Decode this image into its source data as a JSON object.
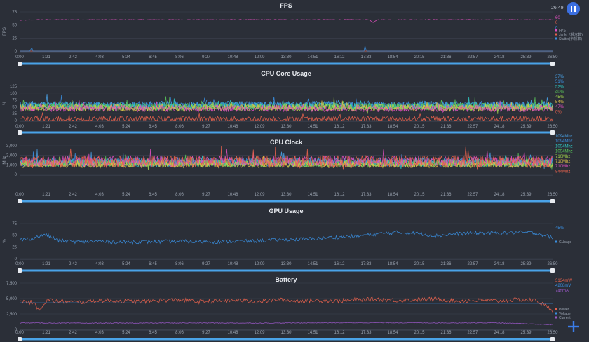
{
  "app": {
    "elapsed": "26:49",
    "colors": {
      "fps": "#e04fbf",
      "jank": "#e8624d",
      "stutter": "#3a8fe0",
      "gpu": "#3a8fe0",
      "power": "#e8624d",
      "voltage": "#3a8fe0",
      "current": "#9b59c9",
      "scrollbar": "#4aa3e8"
    },
    "icons": {
      "pause": "pause-icon",
      "add": "plus-icon"
    }
  },
  "time_axis": [
    "0:00",
    "1:21",
    "2:42",
    "4:03",
    "5:24",
    "6:45",
    "8:06",
    "9:27",
    "10:48",
    "12:09",
    "13:30",
    "14:51",
    "16:12",
    "17:33",
    "18:54",
    "20:15",
    "21:36",
    "22:57",
    "24:18",
    "25:39",
    "26:50"
  ],
  "chart_data": [
    {
      "id": "fps",
      "type": "line",
      "title": "FPS",
      "ylabel": "FPS",
      "ylim": [
        0,
        75
      ],
      "yticks": [
        "0",
        "25",
        "50",
        "75"
      ],
      "x_range_min": [
        0,
        26.83
      ],
      "current_values": [
        "60",
        "0",
        "0"
      ],
      "legend": [
        "FPS",
        "Jank(卡顿次数)",
        "Stutter(卡顿率)"
      ],
      "grid": true,
      "series": [
        {
          "name": "FPS",
          "color": "#e04fbf",
          "x": [
            0,
            1,
            2,
            3,
            4,
            5,
            6,
            7,
            8,
            9,
            10,
            11,
            12,
            13,
            14,
            15,
            16,
            17,
            17.6,
            17.8,
            18,
            19,
            20,
            21,
            22,
            23,
            24,
            25,
            26,
            26.83
          ],
          "values": [
            59,
            60,
            60,
            60,
            60,
            60,
            60,
            60,
            60,
            60,
            60,
            60,
            60,
            60,
            60,
            60,
            60,
            60,
            60,
            54,
            60,
            60,
            60,
            60,
            60,
            60,
            60,
            60,
            60,
            60
          ]
        },
        {
          "name": "Jank(卡顿次数)",
          "color": "#e8624d",
          "x": [
            0,
            26.83
          ],
          "values": [
            0,
            0
          ]
        },
        {
          "name": "Stutter(卡顿率)",
          "color": "#3a8fe0",
          "x": [
            0,
            0.55,
            0.6,
            0.65,
            17.35,
            17.4,
            17.45,
            26.83
          ],
          "values": [
            0,
            0,
            10,
            0,
            0,
            13,
            0,
            0
          ]
        }
      ]
    },
    {
      "id": "cpu_usage",
      "type": "line",
      "title": "CPU Core Usage",
      "ylabel": "%",
      "ylim": [
        0,
        125
      ],
      "yticks": [
        "0",
        "25",
        "50",
        "75",
        "100",
        "125"
      ],
      "x_range_min": [
        0,
        26.83
      ],
      "current_values": [
        "37%",
        "51%",
        "52%",
        "40%",
        "45%",
        "54%",
        "47%",
        "0%"
      ],
      "grid": true,
      "series": [
        {
          "name": "cpu0",
          "color": "#4aa3e8",
          "base": 57,
          "amp": 14
        },
        {
          "name": "cpu1",
          "color": "#3a8fe0",
          "base": 55,
          "amp": 14
        },
        {
          "name": "cpu2",
          "color": "#2fc6c0",
          "base": 52,
          "amp": 13
        },
        {
          "name": "cpu3",
          "color": "#5ac85a",
          "base": 50,
          "amp": 14
        },
        {
          "name": "cpu4",
          "color": "#a4d84a",
          "base": 48,
          "amp": 13
        },
        {
          "name": "cpu5",
          "color": "#e0c04a",
          "base": 46,
          "amp": 12
        },
        {
          "name": "cpu6",
          "color": "#e04fbf",
          "base": 44,
          "amp": 12
        },
        {
          "name": "cpu7",
          "color": "#e8624d",
          "base": 6,
          "amp": 10
        }
      ]
    },
    {
      "id": "cpu_clock",
      "type": "line",
      "title": "CPU Clock",
      "ylabel": "MHz",
      "ylim": [
        0,
        3000
      ],
      "yticks": [
        "0",
        "1,000",
        "2,000",
        "3,000"
      ],
      "x_range_min": [
        0,
        26.83
      ],
      "current_values": [
        "1094Mhz",
        "1094Mhz",
        "1094Mhz",
        "1094Mhz",
        "710Mhz",
        "710Mhz",
        "710Mhz",
        "844Mhz"
      ],
      "grid": true,
      "series": [
        {
          "name": "clock0",
          "color": "#4aa3e8",
          "base": 1300,
          "amp": 450
        },
        {
          "name": "clock1",
          "color": "#3a8fe0",
          "base": 1250,
          "amp": 420
        },
        {
          "name": "clock2",
          "color": "#2fc6c0",
          "base": 1200,
          "amp": 400
        },
        {
          "name": "clock3",
          "color": "#5ac85a",
          "base": 1150,
          "amp": 380
        },
        {
          "name": "clock4",
          "color": "#a4d84a",
          "base": 1100,
          "amp": 360
        },
        {
          "name": "clock5",
          "color": "#e0c04a",
          "base": 1050,
          "amp": 350
        },
        {
          "name": "clock6",
          "color": "#e04fbf",
          "base": 1400,
          "amp": 550
        },
        {
          "name": "clock7",
          "color": "#e8624d",
          "base": 1350,
          "amp": 650
        }
      ]
    },
    {
      "id": "gpu_usage",
      "type": "line",
      "title": "GPU Usage",
      "ylabel": "%",
      "ylim": [
        0,
        75
      ],
      "yticks": [
        "0",
        "25",
        "50",
        "75"
      ],
      "x_range_min": [
        0,
        26.83
      ],
      "current_values": [
        "45%"
      ],
      "legend": [
        "GUsage"
      ],
      "grid": true,
      "series": [
        {
          "name": "GUsage",
          "color": "#3a8fe0",
          "x": [
            0,
            0.5,
            1.0,
            1.3,
            2,
            3,
            4,
            5,
            6,
            7,
            8,
            9,
            10,
            11,
            12,
            13,
            14,
            15,
            16,
            17,
            18,
            19,
            20,
            21,
            22,
            23,
            24,
            25,
            26,
            26.83
          ],
          "values": [
            40,
            42,
            48,
            52,
            38,
            36,
            37,
            35,
            36,
            36,
            37,
            36,
            36,
            37,
            38,
            40,
            41,
            43,
            46,
            48,
            53,
            56,
            54,
            49,
            53,
            55,
            54,
            56,
            55,
            45
          ]
        }
      ]
    },
    {
      "id": "battery",
      "type": "line",
      "title": "Battery",
      "ylabel": "",
      "ylim": [
        0,
        7500
      ],
      "yticks": [
        "0",
        "2,500",
        "5,000",
        "7,500"
      ],
      "x_range_min": [
        0,
        26.83
      ],
      "current_values": [
        "3134mW",
        "4208mV",
        "745mA"
      ],
      "legend": [
        "Power",
        "Voltage",
        "Current"
      ],
      "grid": true,
      "series": [
        {
          "name": "Power",
          "color": "#e8624d",
          "x": [
            0,
            0.6,
            1.0,
            1.4,
            2,
            3,
            4,
            5,
            6,
            7,
            8,
            9,
            10,
            11,
            12,
            13,
            14,
            15,
            16,
            17,
            18,
            19,
            20,
            21,
            22,
            23,
            24,
            25,
            26,
            26.83
          ],
          "values": [
            4600,
            4400,
            3300,
            4800,
            4500,
            4400,
            4700,
            4600,
            4500,
            4700,
            4800,
            4500,
            4600,
            4700,
            4500,
            4800,
            4600,
            4700,
            4600,
            4800,
            4900,
            4700,
            4800,
            4900,
            4600,
            4700,
            4600,
            4800,
            4700,
            3134
          ]
        },
        {
          "name": "Voltage",
          "color": "#3a8fe0",
          "x": [
            0,
            26.83
          ],
          "values": [
            4300,
            4208
          ]
        },
        {
          "name": "Current",
          "color": "#9b59c9",
          "x": [
            0,
            3,
            6,
            9,
            12,
            15,
            18,
            21,
            24,
            26.83
          ],
          "values": [
            1050,
            1000,
            1020,
            1040,
            1010,
            1060,
            1080,
            1050,
            1060,
            745
          ]
        }
      ]
    }
  ]
}
